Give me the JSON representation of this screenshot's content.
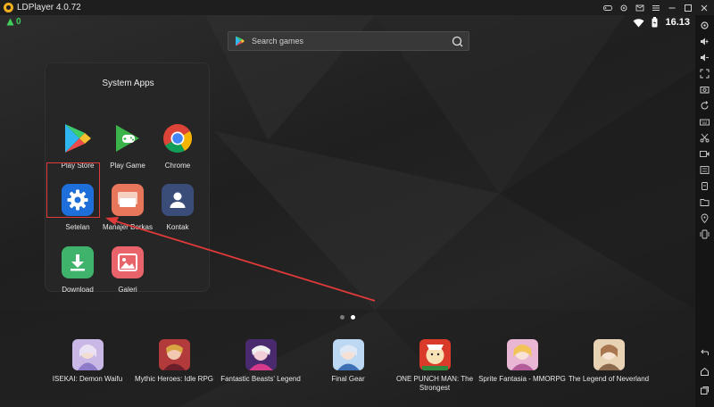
{
  "window": {
    "title": "LDPlayer 4.0.72"
  },
  "status": {
    "notification_count": "0",
    "time": "16.13"
  },
  "search": {
    "placeholder": "Search games"
  },
  "folder": {
    "title": "System Apps",
    "apps": [
      {
        "label": "Play Store",
        "icon": "play-store-icon"
      },
      {
        "label": "Play Game",
        "icon": "play-games-icon"
      },
      {
        "label": "Chrome",
        "icon": "chrome-icon"
      },
      {
        "label": "Setelan",
        "icon": "settings-gear-icon"
      },
      {
        "label": "Manajer Berkas",
        "icon": "file-manager-icon"
      },
      {
        "label": "Kontak",
        "icon": "contacts-icon"
      },
      {
        "label": "Download",
        "icon": "download-icon"
      },
      {
        "label": "Galeri",
        "icon": "gallery-icon"
      }
    ]
  },
  "pager": {
    "pages": 2,
    "active": 2
  },
  "dock": {
    "games": [
      {
        "name": "ISEKAI: Demon Waifu"
      },
      {
        "name": "Mythic Heroes: Idle RPG"
      },
      {
        "name": "Fantastic Beasts' Legend"
      },
      {
        "name": "Final Gear"
      },
      {
        "name": "ONE PUNCH MAN: The Strongest"
      },
      {
        "name": "Sprite Fantasia - MMORPG"
      },
      {
        "name": "The Legend of Neverland"
      }
    ]
  },
  "colors": {
    "highlight": "#e03a3a",
    "accent_green": "#3fd15a",
    "settings_blue": "#1e6fd9"
  }
}
